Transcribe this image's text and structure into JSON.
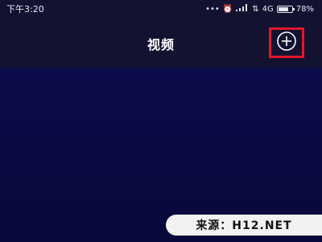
{
  "status_bar": {
    "time": "下午3:20",
    "network": "4G",
    "battery": "78%",
    "battery_level": 0.78
  },
  "nav": {
    "title": "视频"
  },
  "watermark": {
    "text": "来源：H12.NET"
  },
  "colors": {
    "background": "#0a0a3a",
    "header": "#141231",
    "highlight": "#e2172a"
  }
}
